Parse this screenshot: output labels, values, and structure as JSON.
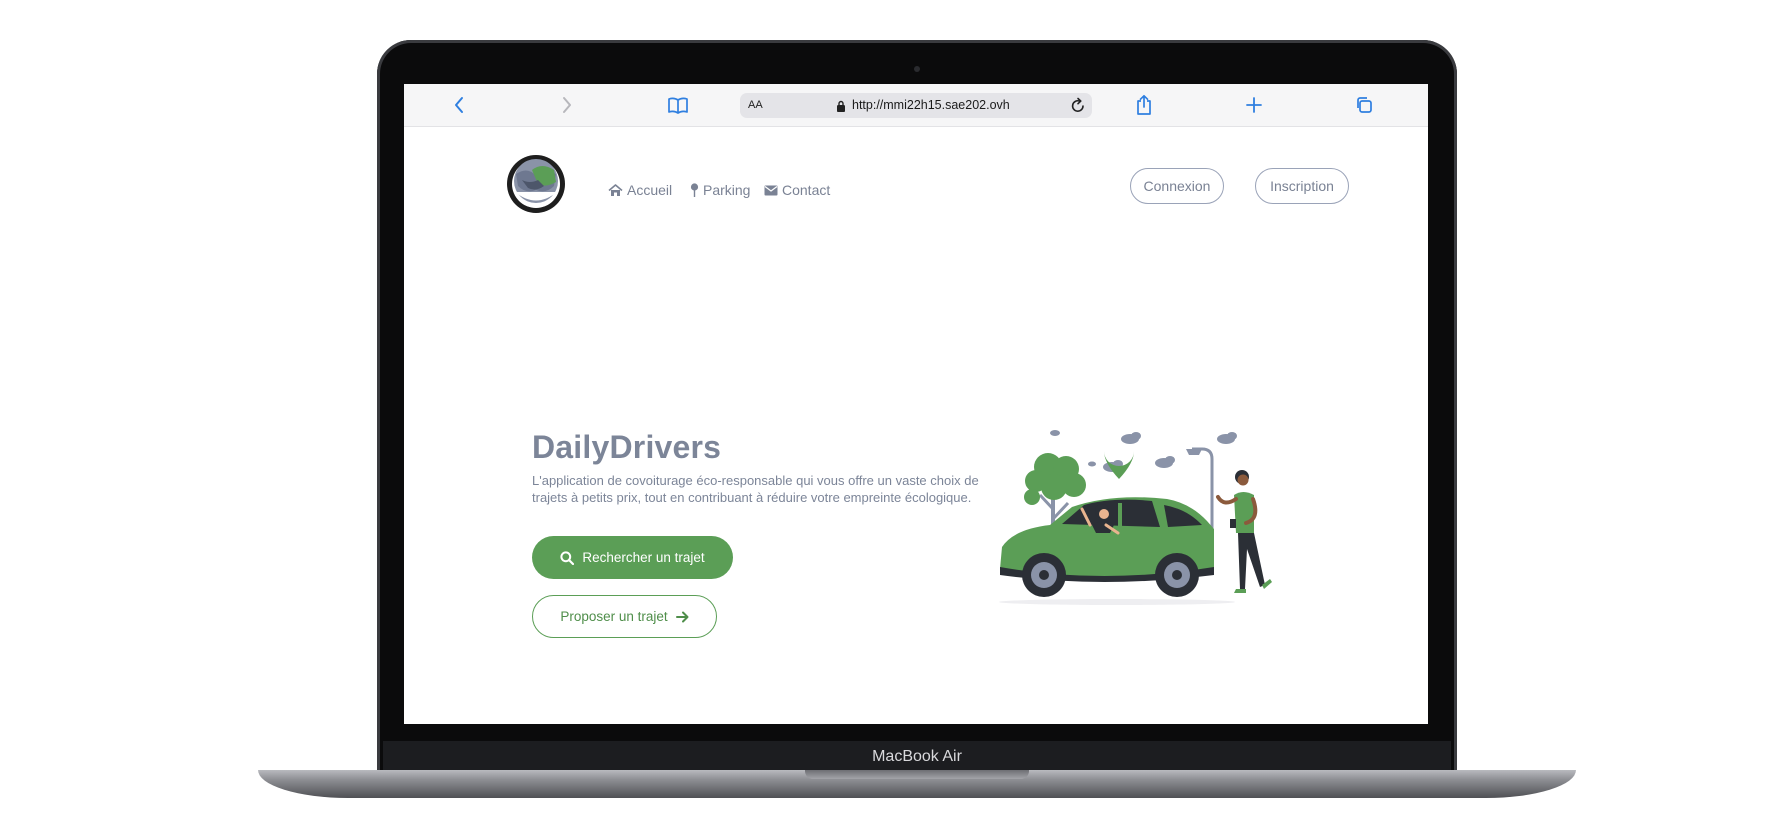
{
  "device": {
    "model_label": "MacBook Air"
  },
  "browser": {
    "address_bar": {
      "text_size_label": "AA",
      "url": "http://mmi22h15.sae202.ovh"
    },
    "icons": {
      "back": "chevron-left-icon",
      "forward": "chevron-right-icon",
      "bookmarks": "book-icon",
      "lock": "lock-icon",
      "reload": "reload-icon",
      "share": "share-icon",
      "new_tab": "plus-icon",
      "tabs": "tabs-icon"
    },
    "accent_color": "#2f7fe0"
  },
  "site": {
    "logo_alt": "Daily Drivers",
    "nav": [
      {
        "label": "Accueil",
        "icon": "home-icon"
      },
      {
        "label": "Parking",
        "icon": "map-pin-icon"
      },
      {
        "label": "Contact",
        "icon": "envelope-icon"
      }
    ],
    "auth": {
      "login": "Connexion",
      "signup": "Inscription"
    },
    "hero": {
      "title": "DailyDrivers",
      "description": "L'application de covoiturage éco-responsable qui vous offre un vaste choix de trajets à petits prix, tout en contribuant à réduire votre empreinte écologique.",
      "primary_button": "Rechercher un trajet",
      "secondary_button": "Proposer un trajet"
    },
    "colors": {
      "brand_green": "#5b9e56",
      "text_grey": "#7c8598",
      "outline_grey": "#9aa3b8"
    }
  }
}
